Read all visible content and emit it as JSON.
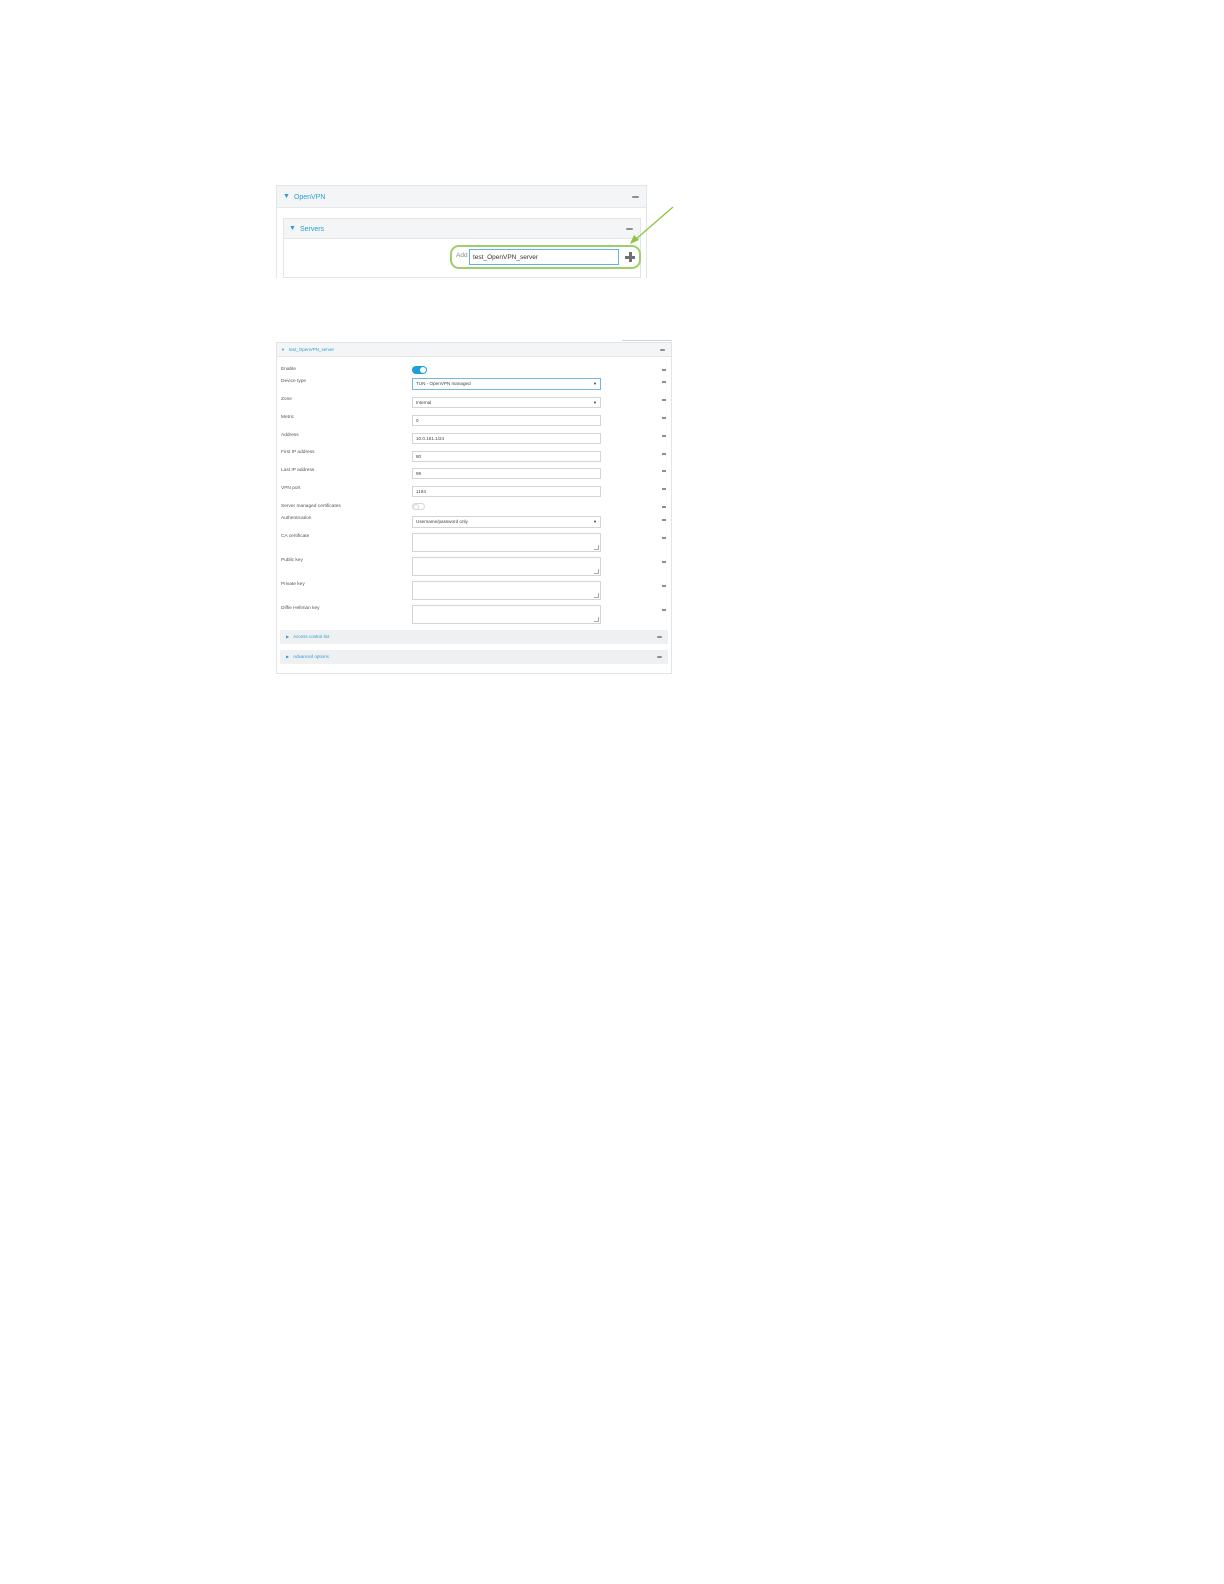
{
  "figure1": {
    "openvpn_title": "OpenVPN",
    "servers_title": "Servers",
    "add_label": "Add",
    "add_input_value": "test_OpenVPN_server"
  },
  "figure2": {
    "section_title": "test_OpenVPN_server",
    "fields": {
      "enable": {
        "label": "Enable",
        "on": true
      },
      "device_type": {
        "label": "Device type",
        "value": "TUN - OpenVPN managed"
      },
      "zone": {
        "label": "Zone",
        "value": "Internal"
      },
      "metric": {
        "label": "Metric",
        "value": "0"
      },
      "address": {
        "label": "Address",
        "value": "10.0.161.1/24"
      },
      "first_ip": {
        "label": "First IP address",
        "value": "80"
      },
      "last_ip": {
        "label": "Last IP address",
        "value": "99"
      },
      "vpn_port": {
        "label": "VPN port",
        "value": "1194"
      },
      "server_managed_certs": {
        "label": "Server managed certificates",
        "on": false
      },
      "authentication": {
        "label": "Authentication",
        "value": "Username/password only"
      },
      "ca_certificate": {
        "label": "CA certificate",
        "value": ""
      },
      "public_key": {
        "label": "Public key",
        "value": ""
      },
      "private_key": {
        "label": "Private key",
        "value": ""
      },
      "diffie_hellman_key": {
        "label": "Diffie Hellman key",
        "value": ""
      }
    },
    "sub_sections": [
      "Access control list",
      "Advanced options"
    ]
  },
  "colors": {
    "accent": "#2a9fd6",
    "highlight": "#9fcf6a"
  }
}
